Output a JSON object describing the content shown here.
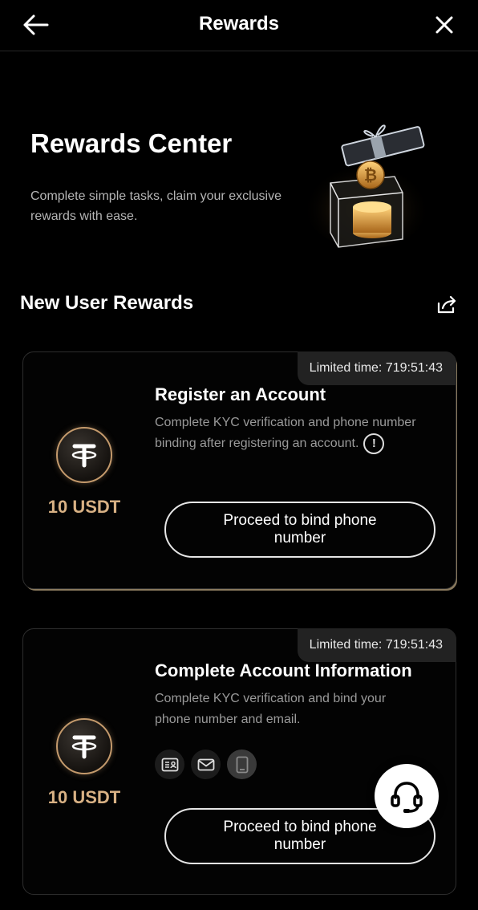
{
  "header": {
    "title": "Rewards",
    "back_icon": "arrow-left-icon",
    "close_icon": "close-icon"
  },
  "hero": {
    "title": "Rewards Center",
    "subtitle": "Complete simple tasks, claim your exclusive rewards with ease.",
    "art_icon": "gift-box-bitcoin-icon"
  },
  "section": {
    "title": "New User Rewards",
    "share_icon": "share-icon"
  },
  "cards": [
    {
      "limited_time": "Limited time: 719:51:43",
      "reward": "10 USDT",
      "coin_icon": "tether-icon",
      "title": "Register an Account",
      "description": "Complete KYC verification and phone number binding after registering an account.",
      "info_icon": "info-icon",
      "button": "Proceed to bind phone number"
    },
    {
      "limited_time": "Limited time: 719:51:43",
      "reward": "10 USDT",
      "coin_icon": "tether-icon",
      "title": "Complete Account Information",
      "description": "Complete KYC verification and bind your phone number and email.",
      "status_icons": [
        "id-card-icon",
        "mail-icon",
        "phone-icon"
      ],
      "button": "Proceed to bind phone number"
    }
  ],
  "support": {
    "icon": "headset-icon"
  },
  "colors": {
    "background": "#000000",
    "accent_gold": "#d8b184",
    "text_secondary": "#9a9a9a"
  }
}
